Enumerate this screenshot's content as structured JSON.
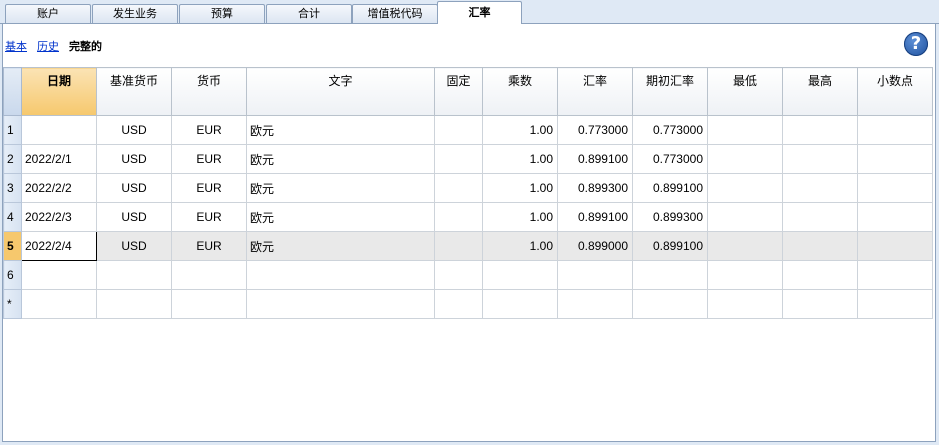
{
  "tabs": [
    {
      "label": "账户",
      "active": false
    },
    {
      "label": "发生业务",
      "active": false
    },
    {
      "label": "预算",
      "active": false
    },
    {
      "label": "合计",
      "active": false
    },
    {
      "label": "增值税代码",
      "active": false
    },
    {
      "label": "汇率",
      "active": true
    }
  ],
  "views": {
    "basic": "基本",
    "history": "历史",
    "complete": "完整的"
  },
  "help": {
    "label": "?"
  },
  "columns": {
    "date": "日期",
    "base_currency": "基准货币",
    "currency": "货币",
    "text": "文字",
    "fixed": "固定",
    "multiplier": "乘数",
    "rate": "汇率",
    "opening_rate": "期初汇率",
    "min": "最低",
    "max": "最高",
    "decimals": "小数点"
  },
  "rows": [
    {
      "num": "1",
      "date": "",
      "base": "USD",
      "cur": "EUR",
      "text": "欧元",
      "fixed": "",
      "mult": "1.00",
      "rate": "0.773000",
      "open": "0.773000",
      "min": "",
      "max": "",
      "dec": ""
    },
    {
      "num": "2",
      "date": "2022/2/1",
      "base": "USD",
      "cur": "EUR",
      "text": "欧元",
      "fixed": "",
      "mult": "1.00",
      "rate": "0.899100",
      "open": "0.773000",
      "min": "",
      "max": "",
      "dec": ""
    },
    {
      "num": "3",
      "date": "2022/2/2",
      "base": "USD",
      "cur": "EUR",
      "text": "欧元",
      "fixed": "",
      "mult": "1.00",
      "rate": "0.899300",
      "open": "0.899100",
      "min": "",
      "max": "",
      "dec": ""
    },
    {
      "num": "4",
      "date": "2022/2/3",
      "base": "USD",
      "cur": "EUR",
      "text": "欧元",
      "fixed": "",
      "mult": "1.00",
      "rate": "0.899100",
      "open": "0.899300",
      "min": "",
      "max": "",
      "dec": ""
    },
    {
      "num": "5",
      "date": "2022/2/4",
      "base": "USD",
      "cur": "EUR",
      "text": "欧元",
      "fixed": "",
      "mult": "1.00",
      "rate": "0.899000",
      "open": "0.899100",
      "min": "",
      "max": "",
      "dec": ""
    },
    {
      "num": "6",
      "date": "",
      "base": "",
      "cur": "",
      "text": "",
      "fixed": "",
      "mult": "",
      "rate": "",
      "open": "",
      "min": "",
      "max": "",
      "dec": ""
    },
    {
      "num": "*",
      "date": "",
      "base": "",
      "cur": "",
      "text": "",
      "fixed": "",
      "mult": "",
      "rate": "",
      "open": "",
      "min": "",
      "max": "",
      "dec": ""
    }
  ]
}
